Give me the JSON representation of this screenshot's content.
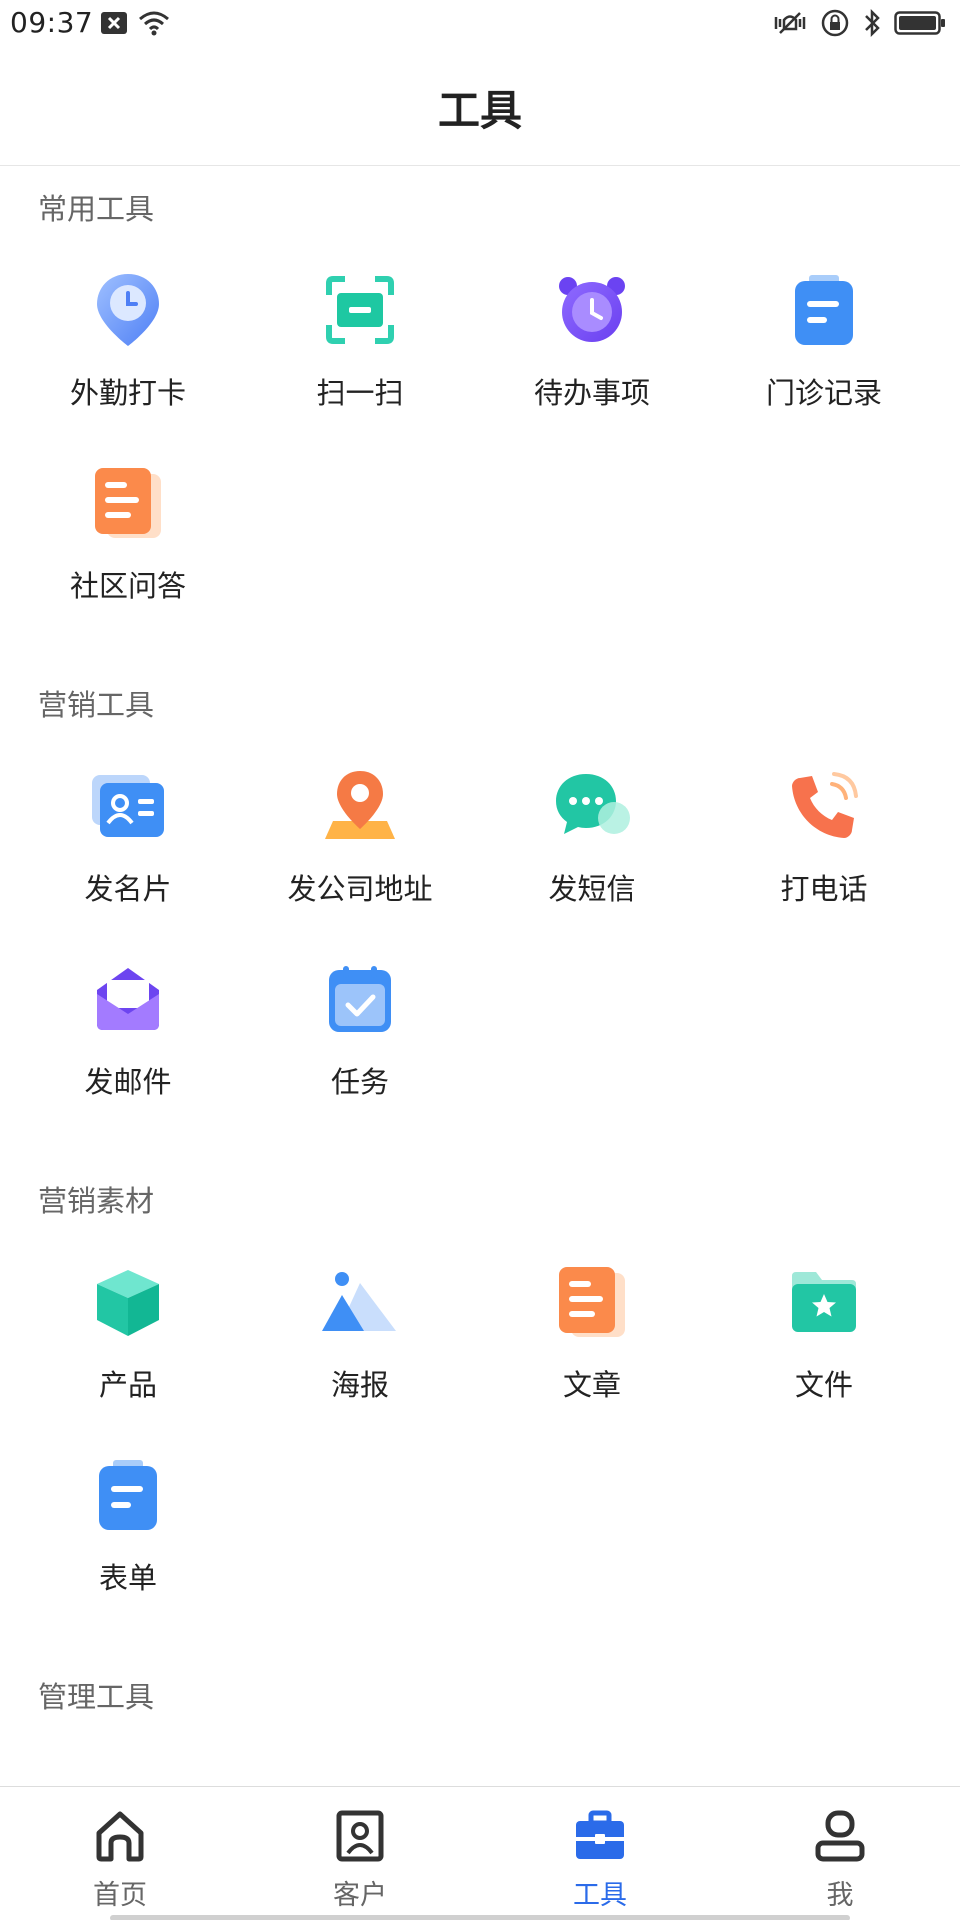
{
  "status_bar": {
    "time": "09:37"
  },
  "header": {
    "title": "工具"
  },
  "sections": [
    {
      "title": "常用工具",
      "items": [
        {
          "label": "外勤打卡",
          "icon": "location-clock-icon"
        },
        {
          "label": "扫一扫",
          "icon": "scan-icon"
        },
        {
          "label": "待办事项",
          "icon": "alarm-clock-icon"
        },
        {
          "label": "门诊记录",
          "icon": "clipboard-icon"
        },
        {
          "label": "社区问答",
          "icon": "document-icon"
        }
      ]
    },
    {
      "title": "营销工具",
      "items": [
        {
          "label": "发名片",
          "icon": "business-card-icon"
        },
        {
          "label": "发公司地址",
          "icon": "map-pin-icon"
        },
        {
          "label": "发短信",
          "icon": "chat-bubble-icon"
        },
        {
          "label": "打电话",
          "icon": "phone-icon"
        },
        {
          "label": "发邮件",
          "icon": "mail-icon"
        },
        {
          "label": "任务",
          "icon": "calendar-check-icon"
        }
      ]
    },
    {
      "title": "营销素材",
      "items": [
        {
          "label": "产品",
          "icon": "cube-icon"
        },
        {
          "label": "海报",
          "icon": "mountain-image-icon"
        },
        {
          "label": "文章",
          "icon": "article-icon"
        },
        {
          "label": "文件",
          "icon": "folder-star-icon"
        },
        {
          "label": "表单",
          "icon": "form-icon"
        }
      ]
    },
    {
      "title": "管理工具",
      "items": []
    }
  ],
  "bottom_nav": [
    {
      "label": "首页",
      "icon": "home-icon",
      "active": false
    },
    {
      "label": "客户",
      "icon": "customer-icon",
      "active": false
    },
    {
      "label": "工具",
      "icon": "toolbox-icon",
      "active": true
    },
    {
      "label": "我",
      "icon": "profile-icon",
      "active": false
    }
  ],
  "colors": {
    "accent": "#2b6be9",
    "section_title": "#666666",
    "divider": "#e6e6e6"
  }
}
